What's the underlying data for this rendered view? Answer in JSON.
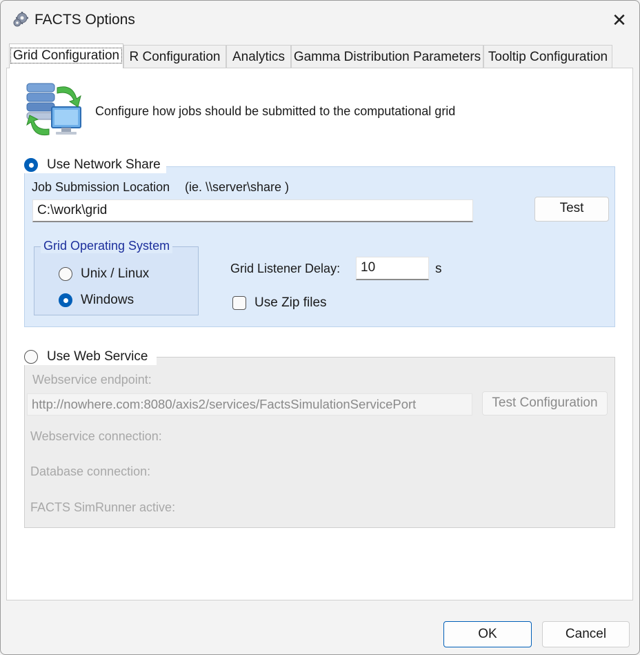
{
  "window": {
    "title": "FACTS Options",
    "app_icon": "gears-icon",
    "close_icon": "close-icon",
    "close_glyph": "✕"
  },
  "tabs": [
    {
      "label": "Grid Configuration",
      "active": true
    },
    {
      "label": "R Configuration",
      "active": false
    },
    {
      "label": "Analytics",
      "active": false
    },
    {
      "label": "Gamma Distribution Parameters",
      "active": false
    },
    {
      "label": "Tooltip Configuration",
      "active": false
    }
  ],
  "header": {
    "icon": "server-network-icon",
    "description": "Configure how jobs should be submitted to the computational grid"
  },
  "network_share": {
    "radio_label": "Use Network Share",
    "selected": true,
    "location_label": "Job Submission Location",
    "location_hint": "(ie. \\\\server\\share )",
    "location_value": "C:\\work\\grid",
    "test_label": "Test",
    "os_group_label": "Grid Operating System",
    "os_options": [
      {
        "label": "Unix / Linux",
        "selected": false
      },
      {
        "label": "Windows",
        "selected": true
      }
    ],
    "listener_delay_label": "Grid Listener Delay:",
    "listener_delay_value": "10",
    "listener_delay_unit": "s",
    "zip_label": "Use Zip files",
    "zip_checked": false
  },
  "web_service": {
    "radio_label": "Use Web Service",
    "selected": false,
    "endpoint_label": "Webservice endpoint:",
    "endpoint_value": "http://nowhere.com:8080/axis2/services/FactsSimulationServicePort",
    "test_config_label": "Test Configuration",
    "status_labels": [
      "Webservice connection:",
      "Database connection:",
      "FACTS SimRunner active:"
    ]
  },
  "footer": {
    "ok_label": "OK",
    "cancel_label": "Cancel"
  },
  "colors": {
    "accent": "#005fb8",
    "network_group_bg": "#deebfa",
    "os_group_title": "#1c2f9c",
    "web_group_bg": "#ededed"
  }
}
